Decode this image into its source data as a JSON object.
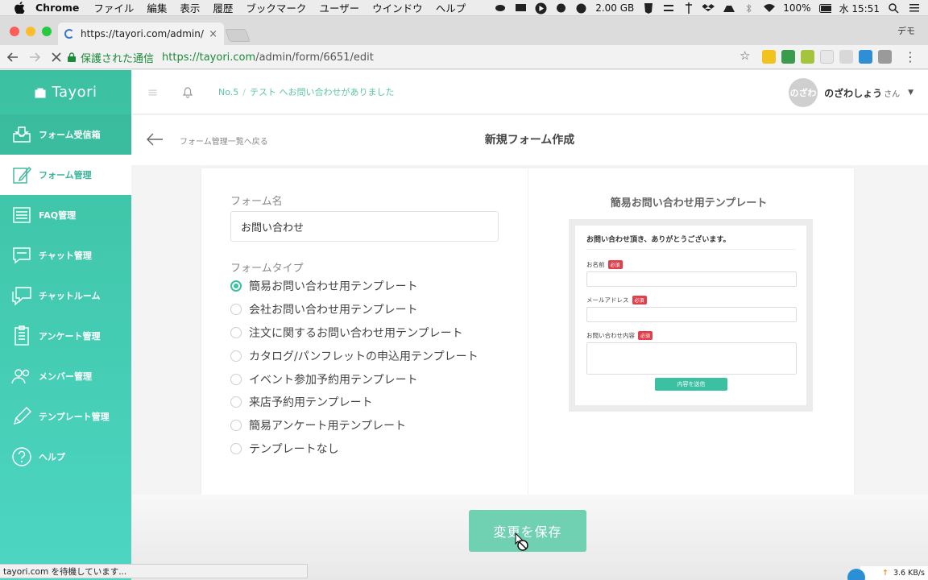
{
  "menubar": {
    "app": "Chrome",
    "menus": [
      "ファイル",
      "編集",
      "表示",
      "履歴",
      "ブックマーク",
      "ユーザー",
      "ウインドウ",
      "ヘルプ"
    ],
    "memory": "2.00 GB",
    "battery": "100%",
    "clock": "水 15:51"
  },
  "browser": {
    "tab_title": "https://tayori.com/admin/form/6651/edit",
    "profile": "デモ",
    "secure_label": "保護された通信",
    "url_host": "https://tayori.com",
    "url_path": "/admin/form/6651/edit",
    "status_text": "tayori.com を待機しています...",
    "net_speed": "3.6 KB/s"
  },
  "sidebar": {
    "brand": "Tayori",
    "items": [
      {
        "label": "フォーム受信箱",
        "icon": "inbox-icon"
      },
      {
        "label": "フォーム管理",
        "icon": "form-edit-icon"
      },
      {
        "label": "FAQ管理",
        "icon": "faq-list-icon"
      },
      {
        "label": "チャット管理",
        "icon": "chat-icon"
      },
      {
        "label": "チャットルーム",
        "icon": "chat-room-icon"
      },
      {
        "label": "アンケート管理",
        "icon": "survey-icon"
      },
      {
        "label": "メンバー管理",
        "icon": "members-icon"
      },
      {
        "label": "テンプレート管理",
        "icon": "pencil-icon"
      },
      {
        "label": "ヘルプ",
        "icon": "help-icon"
      }
    ],
    "active_index": 1
  },
  "header": {
    "notice_no": "No.5",
    "notice_sep": "/",
    "notice_text": "テスト へお問い合わせがありました",
    "avatar_text": "のざわ",
    "user_name": "のざわしょう",
    "user_suffix": "さん"
  },
  "subbar": {
    "back_text": "フォーム管理一覧へ戻る",
    "title": "新規フォーム作成"
  },
  "form": {
    "name_label": "フォーム名",
    "name_value": "お問い合わせ",
    "type_label": "フォームタイプ",
    "types": [
      "簡易お問い合わせ用テンプレート",
      "会社お問い合わせ用テンプレート",
      "注文に関するお問い合わせ用テンプレート",
      "カタログ/パンフレットの申込用テンプレート",
      "イベント参加予約用テンプレート",
      "来店予約用テンプレート",
      "簡易アンケート用テンプレート",
      "テンプレートなし"
    ],
    "selected_index": 0
  },
  "preview": {
    "title": "簡易お問い合わせ用テンプレート",
    "heading": "お問い合わせ頂き、ありがとうございます。",
    "required": "必須",
    "fields": [
      "お名前",
      "メールアドレス",
      "お問い合わせ内容"
    ],
    "submit": "内容を送信"
  },
  "actions": {
    "save": "変更を保存"
  },
  "colors": {
    "brand": "#3bc1a1",
    "required": "#e0404c"
  }
}
